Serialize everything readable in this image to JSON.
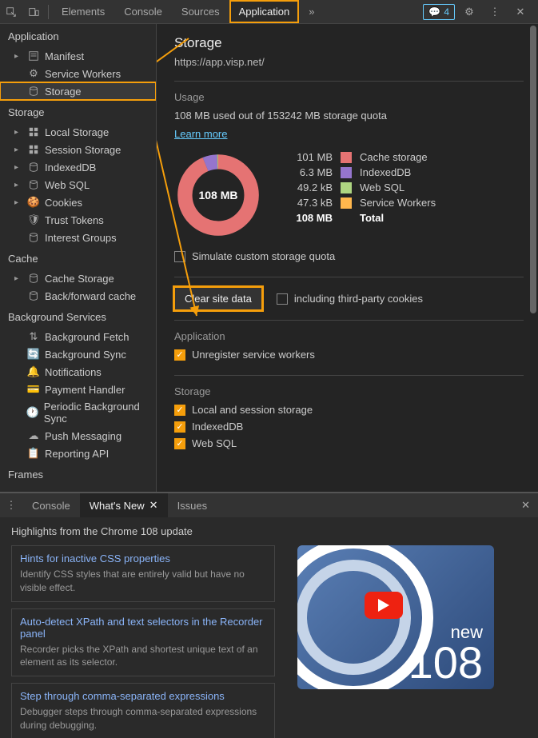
{
  "toolbar": {
    "tabs": [
      "Elements",
      "Console",
      "Sources",
      "Application"
    ],
    "more": "»",
    "msg_count": "4"
  },
  "sidebar": {
    "groups": [
      {
        "title": "Application",
        "items": [
          {
            "icon": "manifest",
            "label": "Manifest",
            "expandable": true
          },
          {
            "icon": "gear",
            "label": "Service Workers"
          },
          {
            "icon": "db",
            "label": "Storage",
            "hl": true
          }
        ]
      },
      {
        "title": "Storage",
        "items": [
          {
            "icon": "grid",
            "label": "Local Storage",
            "expandable": true
          },
          {
            "icon": "grid",
            "label": "Session Storage",
            "expandable": true
          },
          {
            "icon": "db",
            "label": "IndexedDB",
            "expandable": true
          },
          {
            "icon": "db",
            "label": "Web SQL",
            "expandable": true
          },
          {
            "icon": "cookie",
            "label": "Cookies",
            "expandable": true
          },
          {
            "icon": "shield",
            "label": "Trust Tokens"
          },
          {
            "icon": "db",
            "label": "Interest Groups"
          }
        ]
      },
      {
        "title": "Cache",
        "items": [
          {
            "icon": "db",
            "label": "Cache Storage",
            "expandable": true
          },
          {
            "icon": "db",
            "label": "Back/forward cache"
          }
        ]
      },
      {
        "title": "Background Services",
        "items": [
          {
            "icon": "updown",
            "label": "Background Fetch"
          },
          {
            "icon": "sync",
            "label": "Background Sync"
          },
          {
            "icon": "bell",
            "label": "Notifications"
          },
          {
            "icon": "card",
            "label": "Payment Handler"
          },
          {
            "icon": "clock",
            "label": "Periodic Background Sync"
          },
          {
            "icon": "cloud",
            "label": "Push Messaging"
          },
          {
            "icon": "report",
            "label": "Reporting API"
          }
        ]
      },
      {
        "title": "Frames",
        "items": []
      }
    ]
  },
  "page": {
    "title": "Storage",
    "url": "https://app.visp.net/",
    "usage": {
      "title": "Usage",
      "summary": "108 MB used out of 153242 MB storage quota",
      "learn_more": "Learn more",
      "total_label": "108 MB",
      "simulate_label": "Simulate custom storage quota"
    },
    "clear": {
      "button": "Clear site data",
      "third_party": "including third-party cookies"
    },
    "app_section": {
      "title": "Application",
      "unreg": "Unregister service workers"
    },
    "storage_section": {
      "title": "Storage",
      "items": [
        "Local and session storage",
        "IndexedDB",
        "Web SQL"
      ]
    }
  },
  "chart_data": {
    "type": "pie",
    "title": "Storage usage",
    "total": "108 MB",
    "series": [
      {
        "name": "Cache storage",
        "value": "101 MB",
        "value_num": 101,
        "unit": "MB",
        "color": "#e57373"
      },
      {
        "name": "IndexedDB",
        "value": "6.3 MB",
        "value_num": 6.3,
        "unit": "MB",
        "color": "#9575cd"
      },
      {
        "name": "Web SQL",
        "value": "49.2 kB",
        "value_num": 49.2,
        "unit": "kB",
        "color": "#aed581"
      },
      {
        "name": "Service Workers",
        "value": "47.3 kB",
        "value_num": 47.3,
        "unit": "kB",
        "color": "#ffb74d"
      }
    ],
    "total_row": {
      "name": "Total",
      "value": "108 MB"
    }
  },
  "drawer": {
    "tabs": [
      "Console",
      "What's New",
      "Issues"
    ],
    "active": 1,
    "headline": "Highlights from the Chrome 108 update",
    "cards": [
      {
        "title": "Hints for inactive CSS properties",
        "text": "Identify CSS styles that are entirely valid but have no visible effect."
      },
      {
        "title": "Auto-detect XPath and text selectors in the Recorder panel",
        "text": "Recorder picks the XPath and shortest unique text of an element as its selector."
      },
      {
        "title": "Step through comma-separated expressions",
        "text": "Debugger steps through comma-separated expressions during debugging."
      }
    ],
    "promo": {
      "new": "new",
      "num": "108"
    }
  }
}
